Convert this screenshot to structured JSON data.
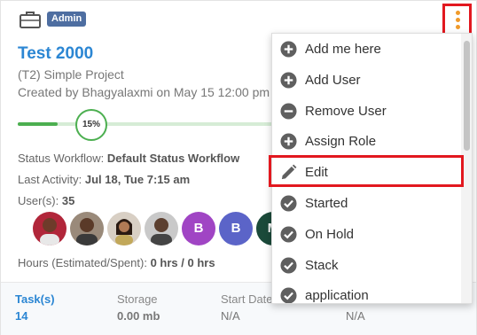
{
  "header": {
    "badge": "Admin",
    "title": "Test 2000",
    "subtitle": "(T2) Simple Project",
    "created": "Created by Bhagyalaxmi on May 15 12:00 pm"
  },
  "progress": {
    "percent_label": "15%",
    "value": 0.15,
    "color": "#4caf50"
  },
  "info": {
    "status_workflow_label": "Status Workflow:",
    "status_workflow_value": "Default Status Workflow",
    "last_activity_label": "Last Activity:",
    "last_activity_value": "Jul 18, Tue 7:15 am",
    "users_label": "User(s):",
    "users_value": "35",
    "hours_label": "Hours (Estimated/Spent):",
    "hours_value": "0 hrs / 0 hrs"
  },
  "avatars": [
    {
      "type": "photo"
    },
    {
      "type": "photo"
    },
    {
      "type": "photo"
    },
    {
      "type": "photo"
    },
    {
      "type": "letter",
      "letter": "B",
      "color": "#a045c4"
    },
    {
      "type": "letter",
      "letter": "B",
      "color": "#5b64c8"
    },
    {
      "type": "letter",
      "letter": "M",
      "color": "#1b4a3a"
    }
  ],
  "footer": {
    "tasks_label": "Task(s)",
    "tasks_value": "14",
    "storage_label": "Storage",
    "storage_value": "0.00 mb",
    "start_label": "Start Date",
    "start_value": "N/A",
    "end_value": "N/A"
  },
  "menu": {
    "items": [
      {
        "label": "Add me here",
        "icon": "plus-circle-icon"
      },
      {
        "label": "Add User",
        "icon": "plus-circle-icon"
      },
      {
        "label": "Remove User",
        "icon": "minus-circle-icon"
      },
      {
        "label": "Assign Role",
        "icon": "plus-circle-icon"
      },
      {
        "label": "Edit",
        "icon": "pencil-icon"
      },
      {
        "label": "Started",
        "icon": "check-circle-icon"
      },
      {
        "label": "On Hold",
        "icon": "check-circle-icon"
      },
      {
        "label": "Stack",
        "icon": "check-circle-icon"
      },
      {
        "label": "application",
        "icon": "check-circle-icon"
      }
    ]
  },
  "colors": {
    "accent": "#2b86d3",
    "badge": "#4e6ea1",
    "kebab": "#f09a2a",
    "highlight": "#e2181f"
  }
}
